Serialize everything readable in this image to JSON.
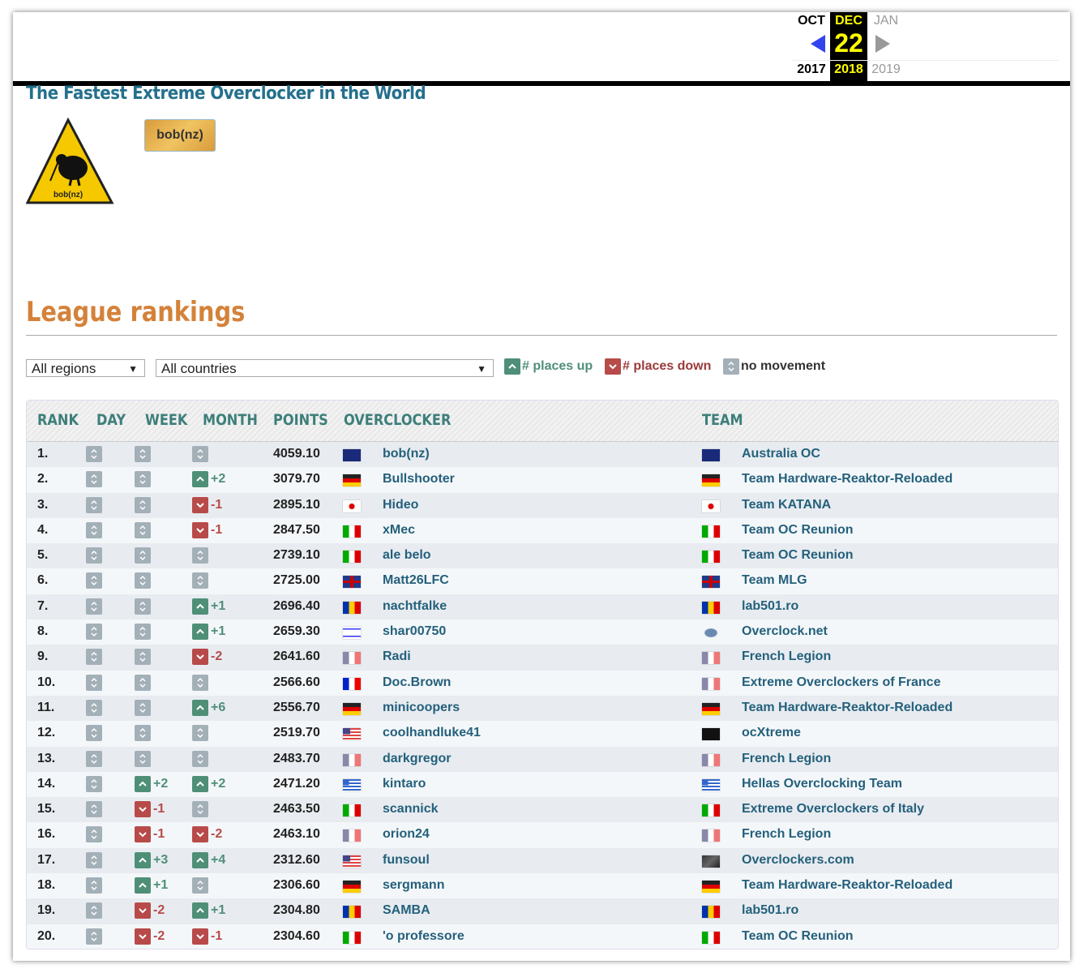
{
  "date": {
    "prev_month": "OCT",
    "month": "DEC",
    "next_month": "JAN",
    "day": "22",
    "prev_year": "2017",
    "year": "2018",
    "next_year": "2019"
  },
  "tagline": "The Fastest Extreme Overclocker in the World",
  "winner": {
    "name": "bob(nz)",
    "logo_text": "bob(nz)"
  },
  "section_title": "League rankings",
  "filters": {
    "region": "All regions",
    "country": "All countries"
  },
  "legend": {
    "up": "# places up",
    "down": "# places down",
    "none": "no movement"
  },
  "colors": {
    "up": "#4f8f78",
    "down": "#b84a4a",
    "none": "#a4b0b8",
    "accent": "#d4823a",
    "link": "#24607c"
  },
  "columns": [
    "RANK",
    "DAY",
    "WEEK",
    "MONTH",
    "POINTS",
    "OVERCLOCKER",
    "TEAM"
  ],
  "rows": [
    {
      "rank": "1.",
      "day": "",
      "week": "",
      "month": "",
      "points": "4059.10",
      "flag": "au",
      "name": "bob(nz)",
      "team_flag": "au",
      "team": "Australia OC"
    },
    {
      "rank": "2.",
      "day": "",
      "week": "",
      "month": "+2",
      "points": "3079.70",
      "flag": "de",
      "name": "Bullshooter",
      "team_flag": "de",
      "team": "Team Hardware-Reaktor-Reloaded"
    },
    {
      "rank": "3.",
      "day": "",
      "week": "",
      "month": "-1",
      "points": "2895.10",
      "flag": "jp",
      "name": "Hideo",
      "team_flag": "jp",
      "team": "Team KATANA"
    },
    {
      "rank": "4.",
      "day": "",
      "week": "",
      "month": "-1",
      "points": "2847.50",
      "flag": "it",
      "name": "xMec",
      "team_flag": "it",
      "team": "Team OC Reunion"
    },
    {
      "rank": "5.",
      "day": "",
      "week": "",
      "month": "",
      "points": "2739.10",
      "flag": "it",
      "name": "ale belo",
      "team_flag": "it",
      "team": "Team OC Reunion"
    },
    {
      "rank": "6.",
      "day": "",
      "week": "",
      "month": "",
      "points": "2725.00",
      "flag": "gb",
      "name": "Matt26LFC",
      "team_flag": "gb",
      "team": "Team MLG"
    },
    {
      "rank": "7.",
      "day": "",
      "week": "",
      "month": "+1",
      "points": "2696.40",
      "flag": "ro",
      "name": "nachtfalke",
      "team_flag": "ro",
      "team": "lab501.ro"
    },
    {
      "rank": "8.",
      "day": "",
      "week": "",
      "month": "+1",
      "points": "2659.30",
      "flag": "il",
      "name": "shar00750",
      "team_flag": "ocn",
      "team": "Overclock.net"
    },
    {
      "rank": "9.",
      "day": "",
      "week": "",
      "month": "-2",
      "points": "2641.60",
      "flag": "frl",
      "name": "Radi",
      "team_flag": "frl",
      "team": "French Legion"
    },
    {
      "rank": "10.",
      "day": "",
      "week": "",
      "month": "",
      "points": "2566.60",
      "flag": "fr",
      "name": "Doc.Brown",
      "team_flag": "frl",
      "team": "Extreme Overclockers of France"
    },
    {
      "rank": "11.",
      "day": "",
      "week": "",
      "month": "+6",
      "points": "2556.70",
      "flag": "de",
      "name": "minicoopers",
      "team_flag": "de",
      "team": "Team Hardware-Reaktor-Reloaded"
    },
    {
      "rank": "12.",
      "day": "",
      "week": "",
      "month": "",
      "points": "2519.70",
      "flag": "us",
      "name": "coolhandluke41",
      "team_flag": "ocx",
      "team": "ocXtreme"
    },
    {
      "rank": "13.",
      "day": "",
      "week": "",
      "month": "",
      "points": "2483.70",
      "flag": "frl",
      "name": "darkgregor",
      "team_flag": "frl",
      "team": "French Legion"
    },
    {
      "rank": "14.",
      "day": "",
      "week": "+2",
      "month": "+2",
      "points": "2471.20",
      "flag": "gr",
      "name": "kintaro",
      "team_flag": "gr",
      "team": "Hellas Overclocking Team"
    },
    {
      "rank": "15.",
      "day": "",
      "week": "-1",
      "month": "",
      "points": "2463.50",
      "flag": "it",
      "name": "scannick",
      "team_flag": "it",
      "team": "Extreme Overclockers of Italy"
    },
    {
      "rank": "16.",
      "day": "",
      "week": "-1",
      "month": "-2",
      "points": "2463.10",
      "flag": "frl",
      "name": "orion24",
      "team_flag": "frl",
      "team": "French Legion"
    },
    {
      "rank": "17.",
      "day": "",
      "week": "+3",
      "month": "+4",
      "points": "2312.60",
      "flag": "us",
      "name": "funsoul",
      "team_flag": "occom",
      "team": "Overclockers.com"
    },
    {
      "rank": "18.",
      "day": "",
      "week": "+1",
      "month": "",
      "points": "2306.60",
      "flag": "de",
      "name": "sergmann",
      "team_flag": "de",
      "team": "Team Hardware-Reaktor-Reloaded"
    },
    {
      "rank": "19.",
      "day": "",
      "week": "-2",
      "month": "+1",
      "points": "2304.80",
      "flag": "ro",
      "name": "SAMBA",
      "team_flag": "ro",
      "team": "lab501.ro"
    },
    {
      "rank": "20.",
      "day": "",
      "week": "-2",
      "month": "-1",
      "points": "2304.60",
      "flag": "it",
      "name": "'o professore",
      "team_flag": "it",
      "team": "Team OC Reunion"
    }
  ]
}
